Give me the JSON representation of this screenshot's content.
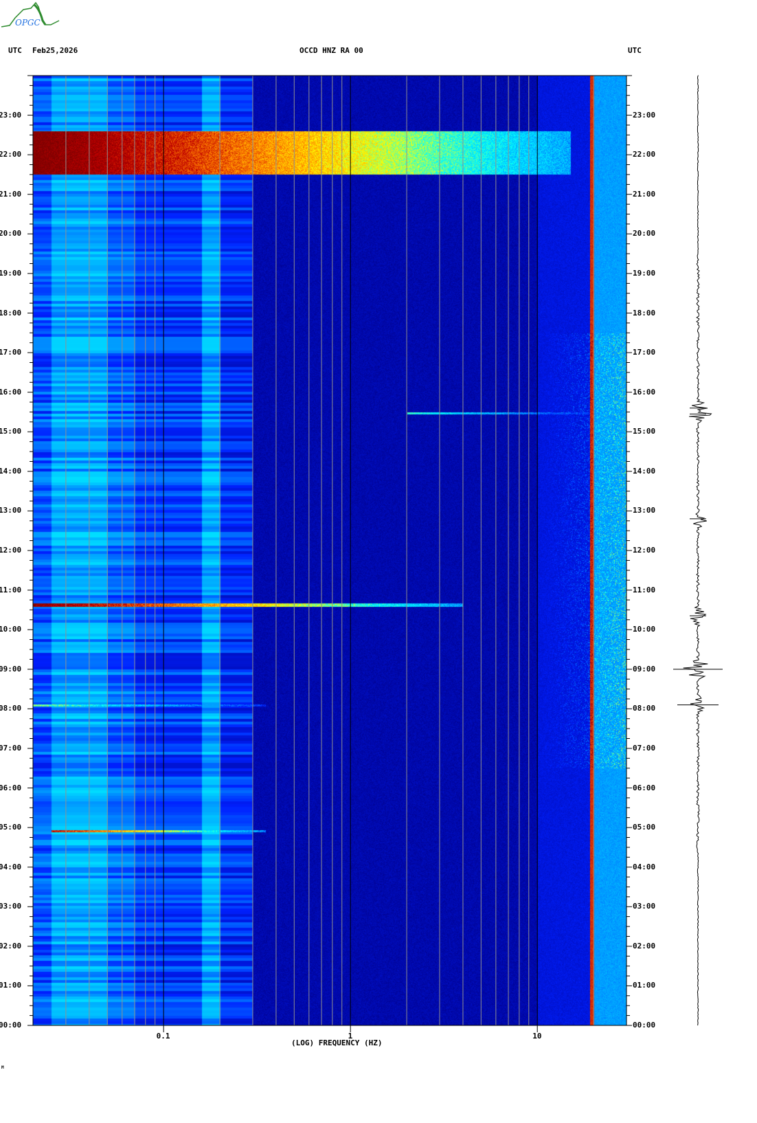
{
  "header": {
    "utc_left": "UTC",
    "date": "Feb25,2026",
    "station": "OCCD HNZ RA 00",
    "utc_right": "UTC"
  },
  "logo": {
    "text": "OPGC"
  },
  "footer_mark": "M",
  "chart_data": {
    "type": "heatmap",
    "title": "OCCD HNZ RA 00",
    "xlabel": "(LOG) FREQUENCY (HZ)",
    "ylabel": "UTC",
    "xscale": "log",
    "xlim": [
      0.02,
      30
    ],
    "ylim": [
      0,
      24
    ],
    "x_ticks": [
      {
        "value": 0.1,
        "label": "0.1"
      },
      {
        "value": 1,
        "label": "1"
      },
      {
        "value": 10,
        "label": "10"
      }
    ],
    "y_ticks": [
      "00:00",
      "01:00",
      "02:00",
      "03:00",
      "04:00",
      "05:00",
      "06:00",
      "07:00",
      "08:00",
      "09:00",
      "10:00",
      "11:00",
      "12:00",
      "13:00",
      "14:00",
      "15:00",
      "16:00",
      "17:00",
      "18:00",
      "19:00",
      "20:00",
      "21:00",
      "22:00",
      "23:00"
    ],
    "colorscale": [
      "#00008c",
      "#0020ff",
      "#00a0ff",
      "#00ffff",
      "#ffff00",
      "#ff8000",
      "#c00000",
      "#800000"
    ],
    "events": [
      {
        "name": "broadband-event",
        "t_start": 21.5,
        "t_end": 22.6,
        "f_min": 0.02,
        "f_max": 15,
        "intensity": 1.0
      },
      {
        "name": "teleseism-line",
        "t_start": 10.58,
        "t_end": 10.68,
        "f_min": 0.02,
        "f_max": 4,
        "intensity": 0.95
      },
      {
        "name": "event-0500",
        "t_start": 4.88,
        "t_end": 4.94,
        "f_min": 0.025,
        "f_max": 0.35,
        "intensity": 0.85
      },
      {
        "name": "event-0800",
        "t_start": 8.06,
        "t_end": 8.11,
        "f_min": 0.02,
        "f_max": 0.35,
        "intensity": 0.5
      },
      {
        "name": "event-1530",
        "t_start": 15.44,
        "t_end": 15.5,
        "f_min": 2,
        "f_max": 20,
        "intensity": 0.45
      }
    ],
    "persistent_line_hz": 19.5,
    "seismogram_bursts_hours": [
      15.6,
      15.45,
      12.8,
      10.35,
      9.0,
      8.1
    ]
  }
}
